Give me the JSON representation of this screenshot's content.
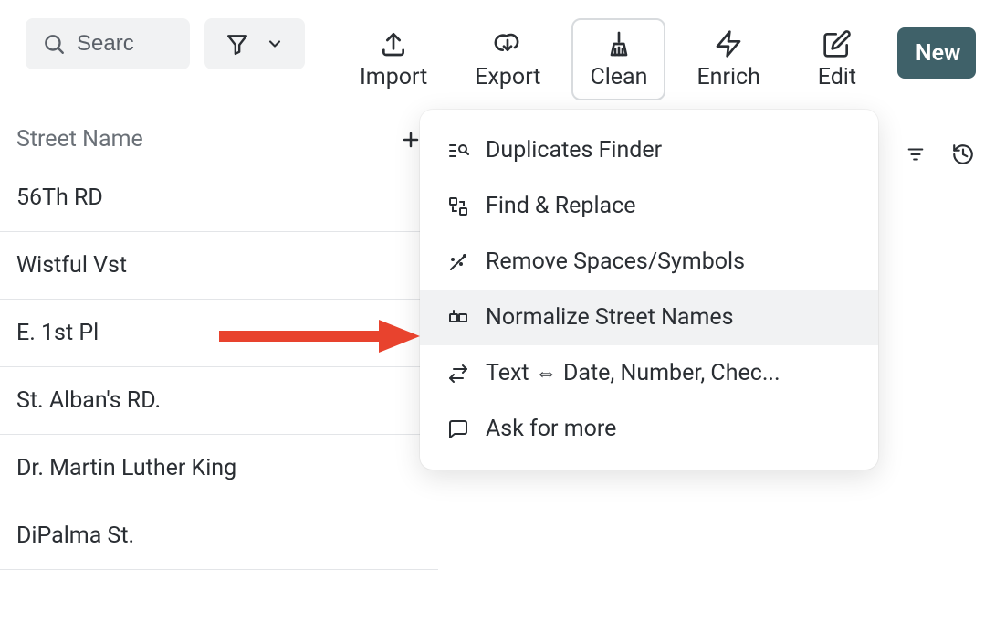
{
  "toolbar": {
    "search_placeholder": "Searc",
    "import_label": "Import",
    "export_label": "Export",
    "clean_label": "Clean",
    "enrich_label": "Enrich",
    "edit_label": "Edit",
    "new_label": "New"
  },
  "column": {
    "header": "Street Name",
    "rows": [
      "56Th RD",
      "Wistful Vst",
      "E. 1st Pl",
      "St. Alban's RD.",
      "Dr. Martin Luther King",
      "DiPalma St."
    ]
  },
  "clean_menu": {
    "duplicates": "Duplicates Finder",
    "find_replace": "Find & Replace",
    "remove_spaces": "Remove Spaces/Symbols",
    "normalize_street": "Normalize Street Names",
    "text_convert": "Text ⇔ Date, Number, Chec...",
    "ask_more": "Ask for more"
  }
}
